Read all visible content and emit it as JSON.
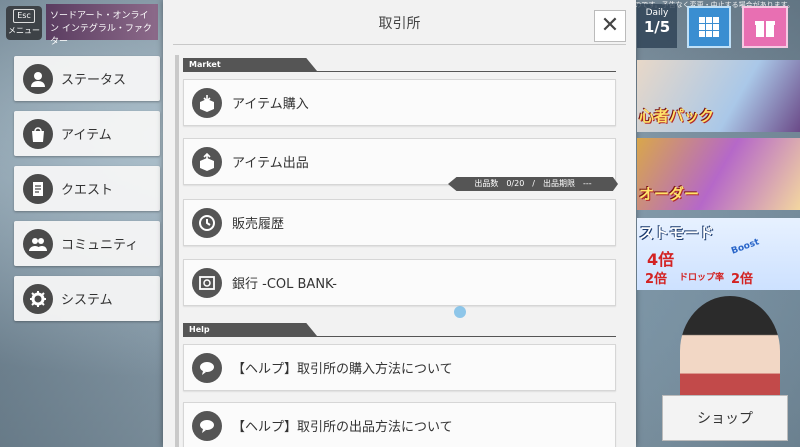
{
  "window": {
    "esc_key": "Esc",
    "esc_label": "メニュー",
    "logo_text": "ソードアート・オンライン インテグラル・ファクター",
    "copyright": "©RK/K/SP ©BNEI 現在の画面は開発中のものです。予告なく変更・中止する場合があります。"
  },
  "sidebar": {
    "items": [
      {
        "label": "ステータス",
        "icon": "person-icon"
      },
      {
        "label": "アイテム",
        "icon": "bag-icon"
      },
      {
        "label": "クエスト",
        "icon": "quest-scroll-icon"
      },
      {
        "label": "コミュニティ",
        "icon": "community-icon"
      },
      {
        "label": "システム",
        "icon": "gear-icon"
      }
    ]
  },
  "modal": {
    "title": "取引所",
    "close_label": "✕",
    "market_section": "Market",
    "help_section": "Help",
    "rows": [
      {
        "label": "アイテム購入",
        "icon": "buy-box-icon"
      },
      {
        "label": "アイテム出品",
        "icon": "sell-box-icon"
      },
      {
        "label": "販売履歴",
        "icon": "history-clock-icon"
      },
      {
        "label": "銀行 -COL BANK-",
        "icon": "bank-safe-icon"
      }
    ],
    "sell_info": "出品数　0/20　/　出品期限　---",
    "help_rows": [
      {
        "label": "【ヘルプ】取引所の購入方法について",
        "icon": "chat-bubble-icon"
      },
      {
        "label": "【ヘルプ】取引所の出品方法について",
        "icon": "chat-bubble-icon"
      }
    ]
  },
  "right_panel": {
    "daily_title": "Daily",
    "daily_value": "1/5",
    "banner1_text": "心者パック",
    "banner2_text": "オーダー",
    "banner3_text": "ストモード",
    "banner3_mult_main": "4倍",
    "banner3_mult_a": "2倍",
    "banner3_droprate": "ドロップ率",
    "banner3_mult_b": "2倍",
    "banner3_boost": "Boost",
    "shop_label": "ショップ"
  }
}
